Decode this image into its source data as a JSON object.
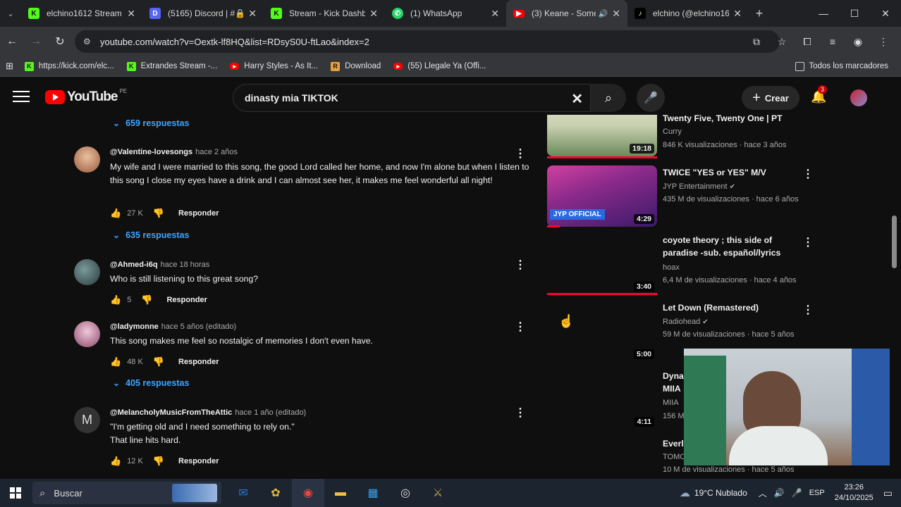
{
  "tabs": [
    {
      "title": "elchino1612 Stream -",
      "icon": "kick",
      "color": "#53fc18",
      "active": false
    },
    {
      "title": "(5165) Discord | #🔒",
      "icon": "discord",
      "color": "#5865f2",
      "active": false
    },
    {
      "title": "Stream - Kick Dashbo",
      "icon": "kick",
      "color": "#53fc18",
      "active": false
    },
    {
      "title": "(1) WhatsApp",
      "icon": "whatsapp",
      "color": "#25d366",
      "active": false
    },
    {
      "title": "(3) Keane - Some",
      "icon": "youtube",
      "color": "#ff0000",
      "active": true
    },
    {
      "title": "elchino (@elchino16",
      "icon": "tiktok",
      "color": "#ffffff",
      "active": false
    }
  ],
  "address": {
    "url": "youtube.com/watch?v=Oextk-lf8HQ&list=RDsyS0U-ftLao&index=2"
  },
  "bookmarks": [
    {
      "label": "https://kick.com/elc...",
      "icon": "kick",
      "color": "#53fc18"
    },
    {
      "label": "Extrandes Stream -...",
      "icon": "kick",
      "color": "#53fc18"
    },
    {
      "label": "Harry Styles - As It...",
      "icon": "youtube",
      "color": "#ff0000"
    },
    {
      "label": "Download",
      "icon": "r",
      "color": "#e8a23a"
    },
    {
      "label": "(55) Llegale Ya (Offi...",
      "icon": "youtube",
      "color": "#ff0000"
    }
  ],
  "bookmarks_all": "Todos los marcadores",
  "yt": {
    "logo_text": "YouTube",
    "country": "PE",
    "search_value": "dinasty mia TIKTOK",
    "create_label": "Crear",
    "notif_count": "3"
  },
  "comments": {
    "replies_top": "659 respuestas",
    "items": [
      {
        "author": "@Valentine-lovesongs",
        "time": "hace 2 años",
        "text": "My wife and I were married to this song, the good Lord called her home, and now I'm alone but when I listen to this song I close my eyes have a drink and I can almost see her, it makes me feel wonderful all night!",
        "likes": "27 K",
        "reply": "Responder",
        "replies": "635 respuestas",
        "avatar_color": "#c98a6a"
      },
      {
        "author": "@Ahmed-i6q",
        "time": "hace 18 horas",
        "text": "Who is still listening to this great song?",
        "likes": "5",
        "reply": "Responder",
        "replies": "",
        "avatar_color": "#4a6a70"
      },
      {
        "author": "@ladymonne",
        "time": "hace 5 años (editado)",
        "text": "This song makes me feel so nostalgic of memories I don't even have.",
        "likes": "48 K",
        "reply": "Responder",
        "replies": "405 respuestas",
        "avatar_color": "#b07a90"
      },
      {
        "author": "@MelancholyMusicFromTheAttic",
        "time": "hace 1 año (editado)",
        "text": "\"I'm getting old and I need something to rely on.\"\nThat line hits hard.",
        "likes": "12 K",
        "reply": "Responder",
        "replies": "",
        "avatar_letter": "M",
        "avatar_color": "#333333"
      }
    ]
  },
  "sidebar": [
    {
      "title": "Twenty Five, Twenty One | PT",
      "channel": "Curry",
      "verified": false,
      "meta": "846 K visualizaciones · hace 3 años",
      "duration": "19:18"
    },
    {
      "title": "TWICE \"YES or YES\" M/V",
      "channel": "JYP Entertainment",
      "verified": true,
      "meta": "435 M de visualizaciones · hace 6 años",
      "duration": "4:29",
      "badge": "JYP OFFICIAL"
    },
    {
      "title": "coyote theory ; this side of paradise -sub. español/lyrics",
      "channel": "hoax",
      "verified": false,
      "meta": "6,4 M de visualizaciones · hace 4 años",
      "duration": "3:40"
    },
    {
      "title": "Let Down (Remastered)",
      "channel": "Radiohead",
      "verified": true,
      "meta": "59 M de visualizaciones · hace 5 años",
      "duration": "5:00"
    },
    {
      "title": "Dyna",
      "title2": "MIIA",
      "channel": "MIIA",
      "meta": "156 M",
      "duration": "4:11"
    },
    {
      "title": "Everl",
      "channel": "TOMO",
      "meta": "10 M de visualizaciones · hace 5 años",
      "duration": ""
    }
  ],
  "taskbar": {
    "search_placeholder": "Buscar",
    "weather": "19°C  Nublado",
    "lang": "ESP",
    "time": "23:26",
    "date": "24/10/2025"
  }
}
